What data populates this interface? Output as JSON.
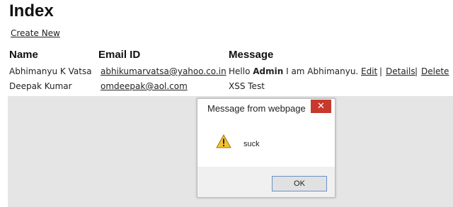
{
  "page": {
    "title": "Index",
    "create_link": "Create New"
  },
  "table": {
    "headers": {
      "name": "Name",
      "email": "Email ID",
      "message": "Message"
    },
    "rows": [
      {
        "name": "Abhimanyu K Vatsa",
        "email": "abhikumarvatsa@yahoo.co.in",
        "message_pre": "Hello ",
        "message_bold": "Admin",
        "message_post": " I am Abhimanyu.",
        "actions": {
          "edit": "Edit",
          "details": "Details",
          "delete": "Delete",
          "separator": "|"
        }
      },
      {
        "name": "Deepak Kumar",
        "email": "omdeepak@aol.com",
        "message_pre": "XSS Test"
      }
    ]
  },
  "dialog": {
    "title": "Message from webpage",
    "close_glyph": "✕",
    "message": "suck",
    "ok_label": "OK",
    "icon": "warning-icon"
  }
}
